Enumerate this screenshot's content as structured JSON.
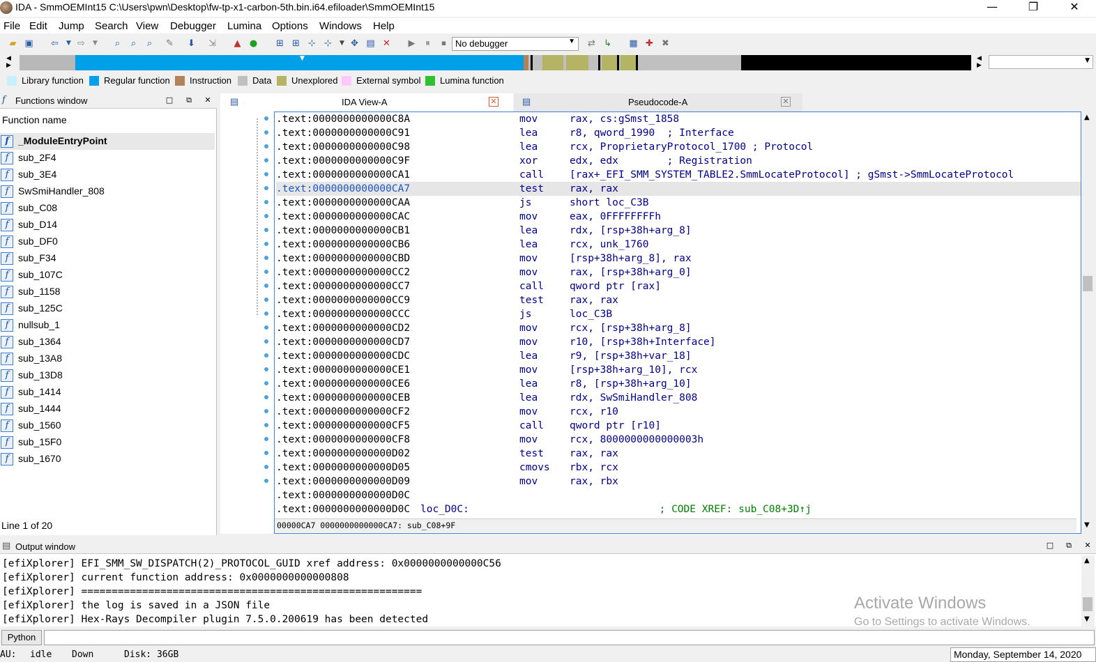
{
  "window": {
    "title": "IDA - SmmOEMInt15 C:\\Users\\pwn\\Desktop\\fw-tp-x1-carbon-5th.bin.i64.efiloader\\SmmOEMInt15",
    "minimize": "—",
    "maximize": "❐",
    "close": "✕"
  },
  "menu": [
    "File",
    "Edit",
    "Jump",
    "Search",
    "View",
    "Debugger",
    "Lumina",
    "Options",
    "Windows",
    "Help"
  ],
  "toolbar": {
    "debugger_select": "No debugger"
  },
  "legend": [
    {
      "label": "Library function",
      "color": "#c8f0ff"
    },
    {
      "label": "Regular function",
      "color": "#00a0e8"
    },
    {
      "label": "Instruction",
      "color": "#b4825a"
    },
    {
      "label": "Data",
      "color": "#c0c0c0"
    },
    {
      "label": "Unexplored",
      "color": "#b4b464"
    },
    {
      "label": "External symbol",
      "color": "#ffc8ff"
    },
    {
      "label": "Lumina function",
      "color": "#30c030"
    }
  ],
  "functions_window": {
    "title": "Functions window",
    "column": "Function name",
    "items": [
      "_ModuleEntryPoint",
      "sub_2F4",
      "sub_3E4",
      "SwSmiHandler_808",
      "sub_C08",
      "sub_D14",
      "sub_DF0",
      "sub_F34",
      "sub_107C",
      "sub_1158",
      "sub_125C",
      "nullsub_1",
      "sub_1364",
      "sub_13A8",
      "sub_13D8",
      "sub_1414",
      "sub_1444",
      "sub_1560",
      "sub_15F0",
      "sub_1670"
    ],
    "line_info": "Line 1 of 20"
  },
  "tabs": [
    {
      "label": "IDA View-A",
      "close": "✕"
    },
    {
      "label": "Pseudocode-A",
      "close": "✕"
    }
  ],
  "disasm": [
    {
      "addr": ".text:0000000000000C8A",
      "mn": "mov",
      "op": "rax, cs:gSmst_1858"
    },
    {
      "addr": ".text:0000000000000C91",
      "mn": "lea",
      "op": "r8, qword_1990  ; Interface"
    },
    {
      "addr": ".text:0000000000000C98",
      "mn": "lea",
      "op": "rcx, ProprietaryProtocol_1700 ; Protocol"
    },
    {
      "addr": ".text:0000000000000C9F",
      "mn": "xor",
      "op": "edx, edx        ; Registration"
    },
    {
      "addr": ".text:0000000000000CA1",
      "mn": "call",
      "op": "[rax+_EFI_SMM_SYSTEM_TABLE2.SmmLocateProtocol] ; gSmst->SmmLocateProtocol"
    },
    {
      "addr": ".text:0000000000000CA7",
      "mn": "test",
      "op": "rax, rax"
    },
    {
      "addr": ".text:0000000000000CAA",
      "mn": "js",
      "op": "short loc_C3B"
    },
    {
      "addr": ".text:0000000000000CAC",
      "mn": "mov",
      "op": "eax, 0FFFFFFFFh"
    },
    {
      "addr": ".text:0000000000000CB1",
      "mn": "lea",
      "op": "rdx, [rsp+38h+arg_8]"
    },
    {
      "addr": ".text:0000000000000CB6",
      "mn": "lea",
      "op": "rcx, unk_1760"
    },
    {
      "addr": ".text:0000000000000CBD",
      "mn": "mov",
      "op": "[rsp+38h+arg_8], rax"
    },
    {
      "addr": ".text:0000000000000CC2",
      "mn": "mov",
      "op": "rax, [rsp+38h+arg_0]"
    },
    {
      "addr": ".text:0000000000000CC7",
      "mn": "call",
      "op": "qword ptr [rax]"
    },
    {
      "addr": ".text:0000000000000CC9",
      "mn": "test",
      "op": "rax, rax"
    },
    {
      "addr": ".text:0000000000000CCC",
      "mn": "js",
      "op": "loc_C3B"
    },
    {
      "addr": ".text:0000000000000CD2",
      "mn": "mov",
      "op": "rcx, [rsp+38h+arg_8]"
    },
    {
      "addr": ".text:0000000000000CD7",
      "mn": "mov",
      "op": "r10, [rsp+38h+Interface]"
    },
    {
      "addr": ".text:0000000000000CDC",
      "mn": "lea",
      "op": "r9, [rsp+38h+var_18]"
    },
    {
      "addr": ".text:0000000000000CE1",
      "mn": "mov",
      "op": "[rsp+38h+arg_10], rcx"
    },
    {
      "addr": ".text:0000000000000CE6",
      "mn": "lea",
      "op": "r8, [rsp+38h+arg_10]"
    },
    {
      "addr": ".text:0000000000000CEB",
      "mn": "lea",
      "op": "rdx, SwSmiHandler_808"
    },
    {
      "addr": ".text:0000000000000CF2",
      "mn": "mov",
      "op": "rcx, r10"
    },
    {
      "addr": ".text:0000000000000CF5",
      "mn": "call",
      "op": "qword ptr [r10]"
    },
    {
      "addr": ".text:0000000000000CF8",
      "mn": "mov",
      "op": "rcx, 8000000000000003h"
    },
    {
      "addr": ".text:0000000000000D02",
      "mn": "test",
      "op": "rax, rax"
    },
    {
      "addr": ".text:0000000000000D05",
      "mn": "cmovs",
      "op": "rbx, rcx"
    },
    {
      "addr": ".text:0000000000000D09",
      "mn": "mov",
      "op": "rax, rbx"
    },
    {
      "addr": ".text:0000000000000D0C",
      "mn": "",
      "op": ""
    },
    {
      "addr": ".text:0000000000000D0C",
      "mn": "loc_D0C:",
      "op": "                               ; CODE XREF: sub_C08+3D↑j"
    }
  ],
  "disasm_status": "00000CA7 0000000000000CA7: sub_C08+9F",
  "output_window": {
    "title": "Output window",
    "lines": [
      "[efiXplorer] EFI_SMM_SW_DISPATCH(2)_PROTOCOL_GUID xref address: 0x0000000000000C56",
      "[efiXplorer] current function address: 0x0000000000000808",
      "[efiXplorer] ========================================================",
      "[efiXplorer] the log is saved in a JSON file",
      "[efiXplorer] Hex-Rays Decompiler plugin 7.5.0.200619 has been detected"
    ]
  },
  "watermark": {
    "line1": "Activate Windows",
    "line2": "Go to Settings to activate Windows."
  },
  "python_button": "Python",
  "statusbar": {
    "au": "AU:",
    "state": "idle",
    "dir": "Down",
    "disk": "Disk: 36GB",
    "date": "Monday, September 14, 2020"
  }
}
